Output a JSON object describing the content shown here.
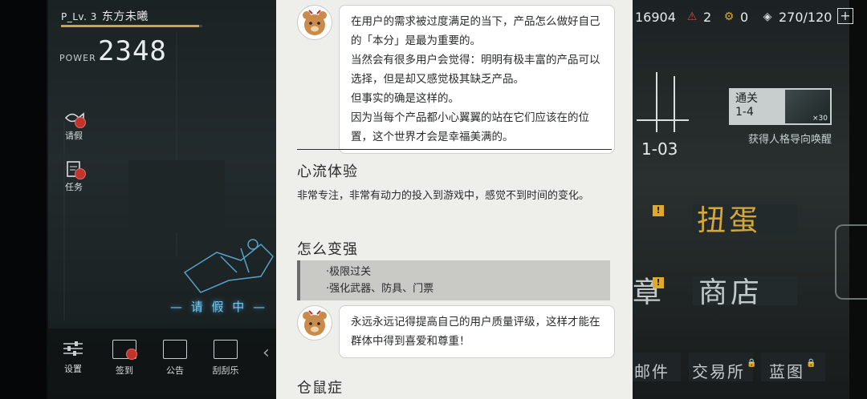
{
  "game": {
    "player": {
      "level": "P_Lv. 3",
      "name": "东方未曦",
      "xp_fraction": 0.98
    },
    "power": {
      "label": "POWER",
      "value": "2348"
    },
    "side_buttons": [
      {
        "label": "请假",
        "icon": "fish-icon",
        "badge": true
      },
      {
        "label": "任务",
        "icon": "clipboard-icon",
        "badge": true
      }
    ],
    "leave_sign": "— 请 假 中 —",
    "bottom_nav": [
      {
        "label": "设置",
        "icon": "sliders-icon"
      },
      {
        "label": "签到",
        "icon": "calendar-icon",
        "badge": true
      },
      {
        "label": "公告",
        "icon": "inbox-icon"
      },
      {
        "label": "刮刮乐",
        "icon": "ticket-icon"
      }
    ],
    "resources": {
      "coins": "16904",
      "warning_count": "2",
      "gear_count": "0",
      "stamina": "270/120",
      "plus": "+"
    },
    "stage": {
      "card_label_1": "通关",
      "card_label_2": "1-4",
      "reward_count": "×30",
      "reward_text": "获得人格导向唤醒",
      "code": "1-03"
    },
    "menu": {
      "gacha": "扭蛋",
      "shop": "商店",
      "chapter": "章",
      "mail": "邮件",
      "trade": "交易所",
      "map": "蓝图"
    },
    "colors": {
      "accent_gold": "#c9a64c",
      "badge_red": "#c2332e",
      "warn_yellow": "#e1a92a",
      "panel_bg": "#eeefea"
    }
  },
  "article": {
    "bubble1": [
      "在用户的需求被过度满足的当下，产品怎么做好自己的「本分」是最为重要的。",
      "当然会有很多用户会觉得：明明有极丰富的产品可以选择，但是却又感觉极其缺乏产品。",
      "但事实的确是这样的。",
      "因为当每个产品都小心翼翼的站在它们应该在的位置，这个世界才会是幸福美满的。"
    ],
    "section1": {
      "title": "心流体验",
      "body": "非常专注，非常有动力的投入到游戏中，感觉不到时间的变化。"
    },
    "section2": {
      "title": "怎么变强",
      "items": [
        "·极限过关",
        "·强化武器、防具、门票"
      ]
    },
    "bubble2": "永远永远记得提高自己的用户质量评级，这样才能在群体中得到喜爱和尊重！",
    "section3": {
      "title": "仓鼠症"
    }
  }
}
